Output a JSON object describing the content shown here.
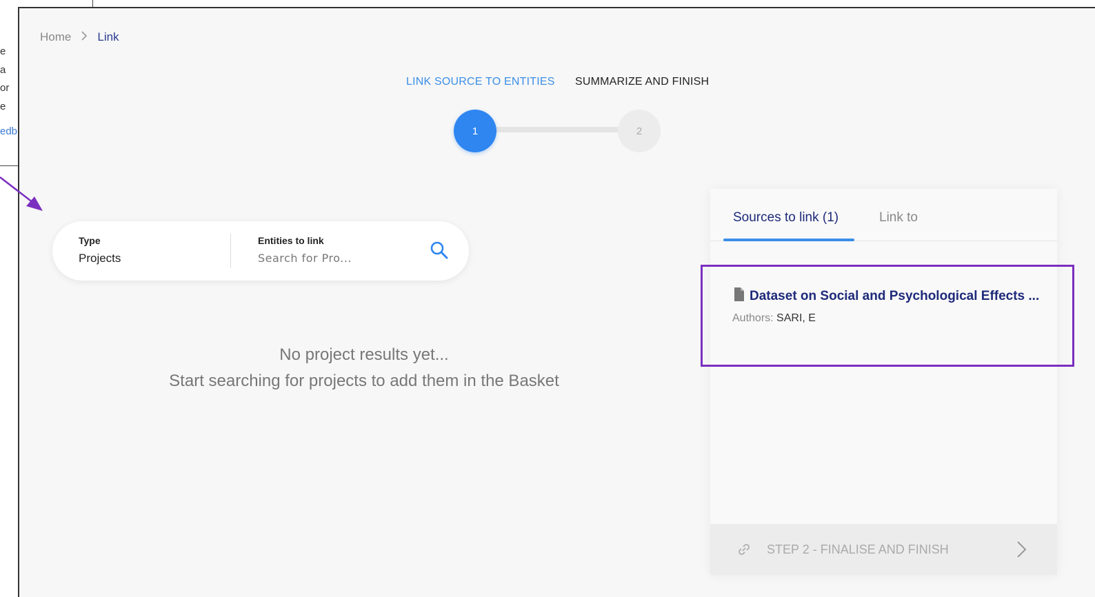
{
  "left_fragments": {
    "line1": "e",
    "line2": "a",
    "line3": "or",
    "line4": "e",
    "line5": "edb"
  },
  "breadcrumb": {
    "home": "Home",
    "separator": ">",
    "current": "Link"
  },
  "steps": {
    "step1_label": "LINK SOURCE TO ENTITIES",
    "step2_label": "SUMMARIZE AND FINISH",
    "step1_number": "1",
    "step2_number": "2",
    "current_step": 1
  },
  "search": {
    "type_label": "Type",
    "type_value": "Projects",
    "entities_label": "Entities to link",
    "placeholder": "Search for Pro..."
  },
  "empty_state": {
    "line1": "No project results yet...",
    "line2": "Start searching for projects to add them in the Basket"
  },
  "side_panel": {
    "tab_sources": "Sources to link (1)",
    "tab_link_to": "Link to",
    "source": {
      "title": "Dataset on Social and Psychological Effects ...",
      "authors_label": "Authors:",
      "authors_value": "SARI, E"
    },
    "finish_label": "STEP 2 - FINALISE AND FINISH"
  },
  "colors": {
    "accent_blue": "#2f86f0",
    "navy": "#1e2a7a",
    "annotation_purple": "#7b2fbf"
  }
}
